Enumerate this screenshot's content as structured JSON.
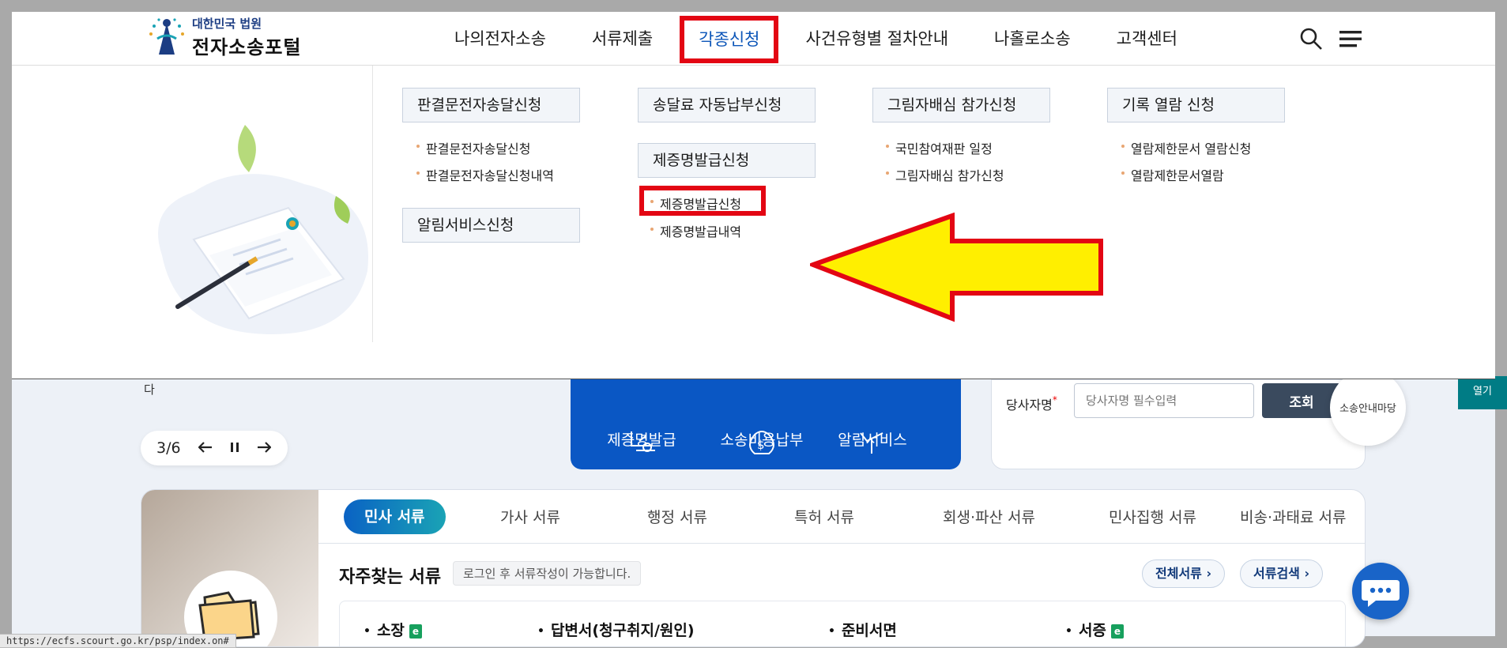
{
  "header": {
    "logo_top": "대한민국 법원",
    "logo_main": "전자소송포털",
    "nav": [
      "나의전자소송",
      "서류제출",
      "각종신청",
      "사건유형별 절차안내",
      "나홀로소송",
      "고객센터"
    ],
    "active_nav_index": 2,
    "icons": [
      "search-icon",
      "hamburger-menu-icon"
    ]
  },
  "mega_menu": {
    "col1": {
      "box1": "판결문전자송달신청",
      "links1": [
        "판결문전자송달신청",
        "판결문전자송달신청내역"
      ],
      "box2": "알림서비스신청"
    },
    "col2": {
      "box1": "송달료 자동납부신청",
      "box2": "제증명발급신청",
      "links2": [
        "제증명발급신청",
        "제증명발급내역"
      ]
    },
    "col3": {
      "box1": "그림자배심 참가신청",
      "links1": [
        "국민참여재판 일정",
        "그림자배심 참가신청"
      ]
    },
    "col4": {
      "box1": "기록 열람 신청",
      "links1": [
        "열람제한문서 열람신청",
        "열람제한문서열람"
      ]
    },
    "highlight_color": "#e30613",
    "arrow_color": "#ffef00"
  },
  "below": {
    "partial_text": "다",
    "slider": {
      "counter": "3/6",
      "icons": [
        "arrow-left-icon",
        "pause-icon",
        "arrow-right-icon"
      ]
    },
    "quick_links": [
      "제증명발급",
      "소송비용납부",
      "알림서비스"
    ],
    "search": {
      "label": "당사자명",
      "required_mark": "*",
      "placeholder": "당사자명 필수입력",
      "button": "조회"
    },
    "float_circle": "소송안내마당",
    "open_tab": "열기",
    "doc_tabs": [
      "민사 서류",
      "가사 서류",
      "행정 서류",
      "특허 서류",
      "회생·파산 서류",
      "민사집행 서류",
      "비송·과태료 서류"
    ],
    "active_doc_tab": 0,
    "freq_title": "자주찾는 서류",
    "freq_note": "로그인 후 서류작성이 가능합니다.",
    "all_docs_btn": "전체서류",
    "doc_search_btn": "서류검색",
    "doc_items": [
      "소장",
      "답변서(청구취지/원인)",
      "준비서면",
      "서증"
    ],
    "e_badge": "e"
  },
  "status_url": "https://ecfs.scourt.go.kr/psp/index.on#",
  "colors": {
    "brand_blue": "#0a57c4",
    "nav_active": "#0b55b8",
    "teal": "#007c85"
  }
}
